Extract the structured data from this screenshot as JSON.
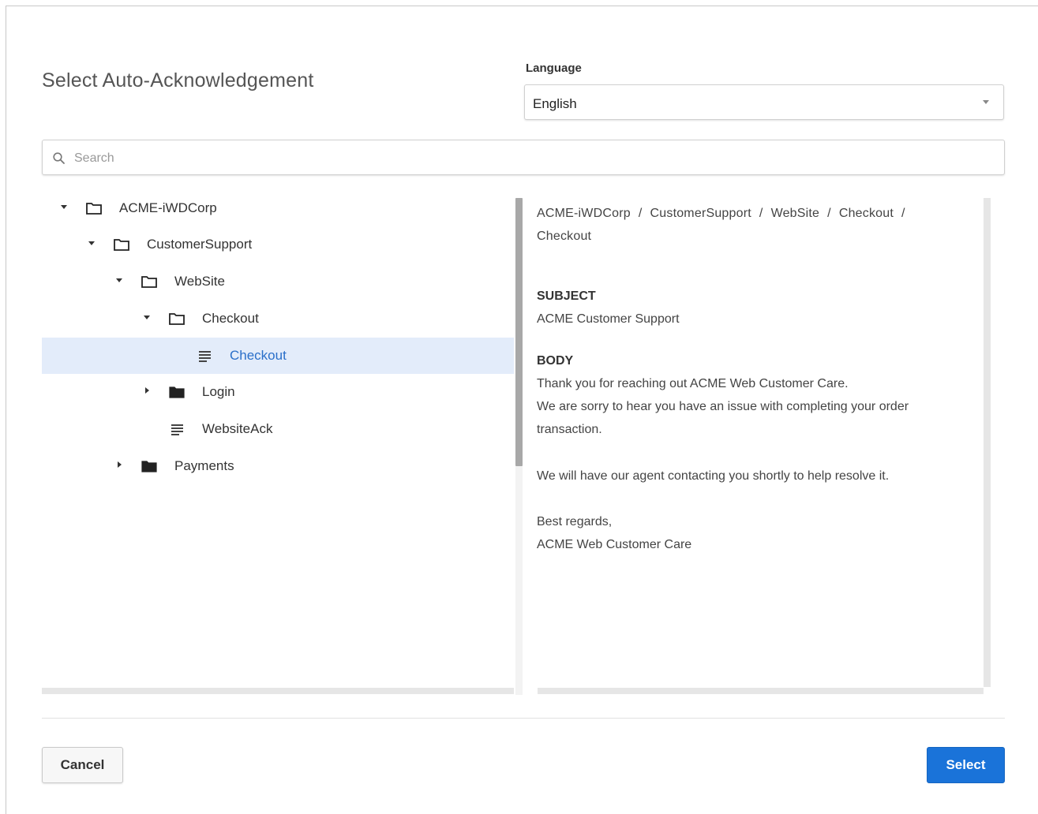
{
  "dialog": {
    "title": "Select Auto-Acknowledgement"
  },
  "language": {
    "label": "Language",
    "value": "English"
  },
  "search": {
    "placeholder": "Search",
    "value": ""
  },
  "tree": {
    "items": [
      {
        "label": "ACME-iWDCorp",
        "type": "folder-open",
        "expanded": true,
        "selected": false
      },
      {
        "label": "CustomerSupport",
        "type": "folder-open",
        "expanded": true,
        "selected": false
      },
      {
        "label": "WebSite",
        "type": "folder-open",
        "expanded": true,
        "selected": false
      },
      {
        "label": "Checkout",
        "type": "folder-open",
        "expanded": true,
        "selected": false
      },
      {
        "label": "Checkout",
        "type": "document",
        "expanded": false,
        "selected": true
      },
      {
        "label": "Login",
        "type": "folder-closed",
        "expanded": false,
        "selected": false
      },
      {
        "label": "WebsiteAck",
        "type": "document",
        "expanded": false,
        "selected": false
      },
      {
        "label": "Payments",
        "type": "folder-closed",
        "expanded": false,
        "selected": false
      }
    ]
  },
  "preview": {
    "breadcrumb": [
      "ACME-iWDCorp",
      "CustomerSupport",
      "WebSite",
      "Checkout",
      "Checkout"
    ],
    "breadcrumb_separator": "/",
    "subject_heading": "SUBJECT",
    "subject_text": "ACME Customer Support",
    "body_heading": "BODY",
    "body_lines": [
      "Thank you for reaching out ACME Web Customer Care.",
      "We are sorry to hear you have an issue with completing your order transaction.",
      "We will have our agent contacting you shortly to help resolve it.",
      "Best regards,",
      "ACME Web Customer Care"
    ]
  },
  "footer": {
    "cancel_label": "Cancel",
    "select_label": "Select"
  },
  "colors": {
    "primary": "#1a73d9",
    "selected_row_bg": "#e3ecfa",
    "selected_text": "#2a6fc9"
  }
}
